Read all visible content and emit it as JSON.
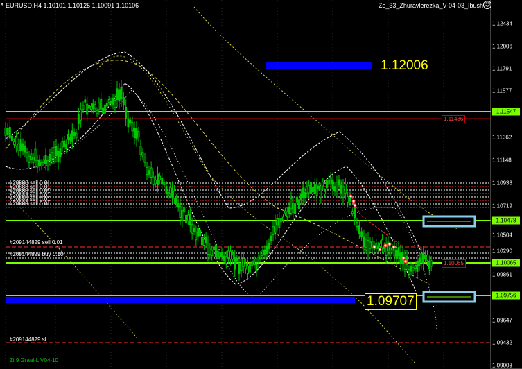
{
  "header": {
    "symbol_info": "EURUSD,H4  1.10101 1.10125 1.10091 1.10106",
    "expert_name": "Ze_33_Zhuravlerezka_V-04-03_Ibush",
    "drop_arrow": "▼"
  },
  "price_axis": {
    "ticks": [
      "1.12434",
      "1.12006",
      "1.11791",
      "1.11577",
      "1.11362",
      "1.11148",
      "1.10933",
      "1.10719",
      "1.10504",
      "1.10290",
      "1.10076",
      "1.09861",
      "1.09647",
      "1.09432",
      "1.09218",
      "1.09003"
    ],
    "labels": {
      "top_line": "1.11547",
      "red_level": "1.11486",
      "upper_green": "1.10478",
      "current": "1.10065",
      "red_mid": "1.10065",
      "lower_green": "1.09756"
    }
  },
  "levels": {
    "upper_target": "1.12006",
    "lower_target": "1.09707"
  },
  "orders": {
    "sell_block": [
      "#20888 sell 0.01",
      "#20888 sell 0.01",
      "#20888 sell 0.01",
      "#20888 sell 0.01",
      "#20889 sell 0.01",
      "#20889 sell 0.01"
    ],
    "sell_single": "#209144829 sell 0.01",
    "buy_single": "#209144829 buy 0.10",
    "sl_label": "#209144829 sl"
  },
  "footer": {
    "text": "Zi 9 Graal-L  V04-10"
  },
  "colors": {
    "background": "#000000",
    "candles": "#00c800",
    "green_line": "#7cfc00",
    "blue_bar": "#0000ff",
    "yellow_box": "#ffff00",
    "cyan_box": "#87ceeb",
    "red": "#c00000"
  }
}
